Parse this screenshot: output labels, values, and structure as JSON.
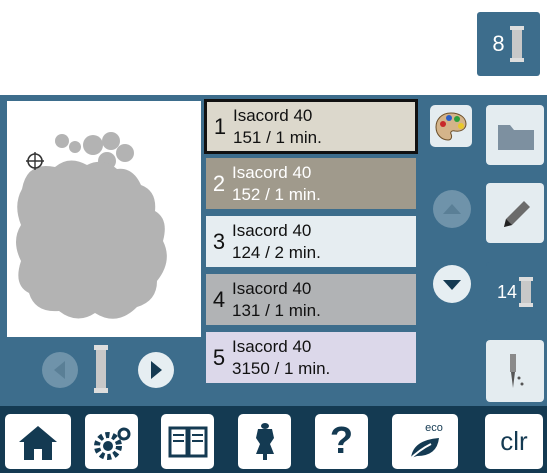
{
  "top_thread_button": {
    "number": "8"
  },
  "color_list": [
    {
      "index": "1",
      "name": "Isacord 40",
      "detail": "151 / 1 min.",
      "bg": "#dcd8cc",
      "dark": false,
      "selected": true
    },
    {
      "index": "2",
      "name": "Isacord 40",
      "detail": "152 / 1 min.",
      "bg": "#a09a8c",
      "dark": true,
      "selected": false
    },
    {
      "index": "3",
      "name": "Isacord 40",
      "detail": "124 / 2 min.",
      "bg": "#e6edf1",
      "dark": false,
      "selected": false
    },
    {
      "index": "4",
      "name": "Isacord 40",
      "detail": "131 / 1 min.",
      "bg": "#b1b3b5",
      "dark": false,
      "selected": false
    },
    {
      "index": "5",
      "name": "Isacord 40",
      "detail": "3150 / 1 min.",
      "bg": "#dcd8ea",
      "dark": false,
      "selected": false
    }
  ],
  "thread_count_button": {
    "number": "14"
  },
  "toolbar": {
    "clr_label": "clr",
    "help_label": "?",
    "eco_label": "eco"
  },
  "colors": {
    "panel": "#3d6d8c",
    "toolbar": "#143a52",
    "preview_bg": "#ffffff"
  }
}
